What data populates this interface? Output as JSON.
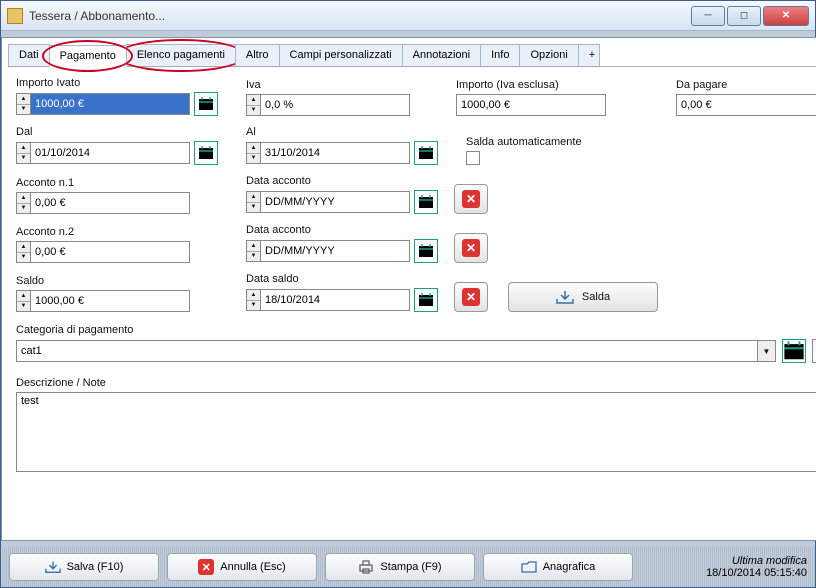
{
  "window": {
    "title": "Tessera / Abbonamento..."
  },
  "tabs": {
    "dati": "Dati",
    "pagamento": "Pagamento",
    "elenco": "Elenco pagamenti",
    "altro": "Altro",
    "campi": "Campi personalizzati",
    "annotazioni": "Annotazioni",
    "info": "Info",
    "opzioni": "Opzioni",
    "plus": "+"
  },
  "labels": {
    "importo_ivato": "Importo Ivato",
    "iva": "Iva",
    "importo_escl": "Importo (Iva esclusa)",
    "da_pagare": "Da pagare",
    "dal": "Dal",
    "al": "Al",
    "salda_auto": "Salda automaticamente",
    "acconto1": "Acconto n.1",
    "data_acconto": "Data acconto",
    "acconto2": "Acconto n.2",
    "saldo": "Saldo",
    "data_saldo": "Data saldo",
    "salda_btn": "Salda",
    "cat": "Categoria di pagamento",
    "desc": "Descrizione / Note"
  },
  "values": {
    "importo_ivato": "1000,00 €",
    "iva": "0,0 %",
    "importo_escl": "1000,00 €",
    "da_pagare": "0,00 €",
    "dal": "01/10/2014",
    "al": "31/10/2014",
    "acconto1": "0,00 €",
    "data_acconto1": "DD/MM/YYYY",
    "acconto2": "0,00 €",
    "data_acconto2": "DD/MM/YYYY",
    "saldo": "1000,00 €",
    "data_saldo": "18/10/2014",
    "cat": "cat1",
    "desc": "test"
  },
  "footer": {
    "salva": "Salva  (F10)",
    "annulla": "Annulla  (Esc)",
    "stampa": "Stampa  (F9)",
    "anagrafica": "Anagrafica",
    "ultima_label": "Ultima modifica",
    "ultima_val": "18/10/2014 05:15:40"
  }
}
